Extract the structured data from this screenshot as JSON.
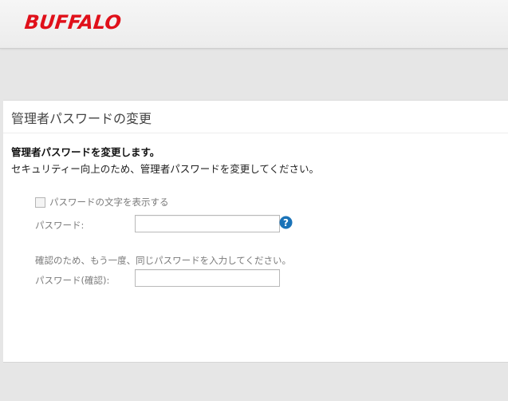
{
  "header": {
    "logo_text": "BUFFALO",
    "brand_color": "#e0101a"
  },
  "panel": {
    "title": "管理者パスワードの変更",
    "heading": "管理者パスワードを変更します。",
    "description": "セキュリティー向上のため、管理者パスワードを変更してください。"
  },
  "form": {
    "show_password_label": "パスワードの文字を表示する",
    "show_password_checked": false,
    "password_label": "パスワード:",
    "password_value": "",
    "help_icon": "question-circle-icon",
    "confirm_note": "確認のため、もう一度、同じパスワードを入力してください。",
    "confirm_label": "パスワード(確認):",
    "confirm_value": ""
  }
}
